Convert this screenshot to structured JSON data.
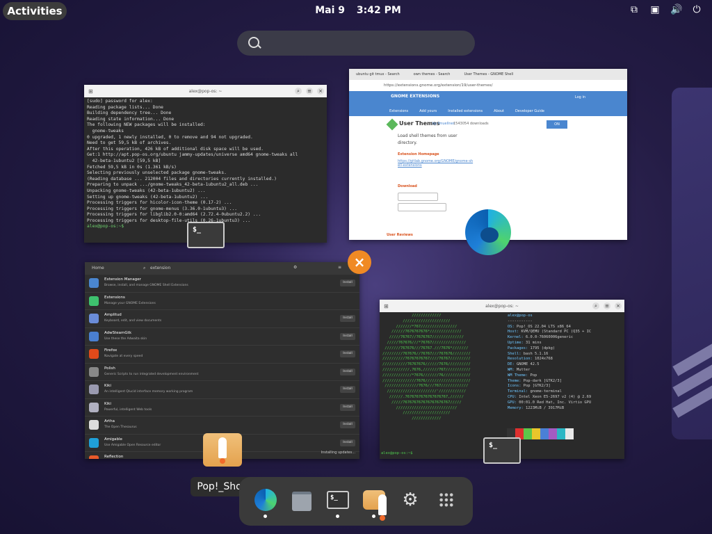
{
  "topbar": {
    "activities_label": "Activities",
    "date": "Mai 9",
    "time": "3:42 PM",
    "tray_icons": [
      "screen-share-icon",
      "keyboard-layout-icon",
      "volume-icon",
      "power-icon"
    ]
  },
  "search": {
    "placeholder": ""
  },
  "terminal_window": {
    "title": "alex@pop-os: ~",
    "lines": [
      "[sudo] password for alex:",
      "Reading package lists... Done",
      "Building dependency tree... Done",
      "Reading state information... Done",
      "The following NEW packages will be installed:",
      "  gnome-tweaks",
      "0 upgraded, 1 newly installed, 0 to remove and 94 not upgraded.",
      "Need to get 59,5 kB of archives.",
      "After this operation, 426 kB of additional disk space will be used.",
      "Get:1 http://apt.pop-os.org/ubuntu jammy-updates/universe amd64 gnome-tweaks all",
      "  42-beta-1ubuntu2 [59,5 kB]",
      "Fetched 59,5 kB in 0s (1.361 kB/s)",
      "Selecting previously unselected package gnome-tweaks.",
      "(Reading database ... 212004 files and directories currently installed.)",
      "Preparing to unpack .../gnome-tweaks_42-beta-1ubuntu2_all.deb ...",
      "Unpacking gnome-tweaks (42-beta-1ubuntu2) ...",
      "Setting up gnome-tweaks (42-beta-1ubuntu2) ...",
      "Processing triggers for hicolor-icon-theme (0.17-2) ...",
      "Processing triggers for gnome-menus (3.36.0-1ubuntu3) ...",
      "Processing triggers for libglib2.0-0:amd64 (2.72.4-0ubuntu2.2) ...",
      "Processing triggers for desktop-file-utils (0.26-1ubuntu3) ...",
      "alex@pop-os:~$ "
    ]
  },
  "browser_window": {
    "tabs": [
      "ubuntu git tmux - Search",
      "own themes - Search",
      "User Themes - GNOME Shell"
    ],
    "url": "https://extensions.gnome.org/extension/19/user-themes/",
    "site_logo": "GNOME EXTENSIONS",
    "nav": [
      "Extensions",
      "Add yours",
      "Installed extensions",
      "About",
      "Developer Guide"
    ],
    "login": "Log in",
    "ext_title": "User Themes",
    "ext_author": "by fmuellner",
    "ext_downloads": "1543054 downloads",
    "ext_desc": "Load shell themes from user directory.",
    "homepage_label": "Extension Homepage",
    "homepage_url": "https://gitlab.gnome.org/GNOME/gnome-shell-extensions",
    "download_label": "Download",
    "reviews_label": "User Reviews",
    "toggle": "ON"
  },
  "shop_window": {
    "home_label": "Home",
    "search_value": "extension",
    "installing_label": "Installing updates...",
    "items": [
      {
        "name": "Extension Manager",
        "desc": "Browse, install, and manage GNOME Shell Extensions",
        "action": "Install",
        "color": "#4a86cf"
      },
      {
        "name": "Extensions",
        "desc": "Manage your GNOME Extensions",
        "action": "",
        "color": "#3ec26e"
      },
      {
        "name": "Amplitud",
        "desc": "Keyboard, edit, and view documents",
        "action": "Install",
        "color": "#6a8cd8"
      },
      {
        "name": "AdwSteamGtk",
        "desc": "Use these the Adwaita skin",
        "action": "Install",
        "color": "#4a7fd0"
      },
      {
        "name": "Firefox",
        "desc": "Navigate at every speed",
        "action": "Install",
        "color": "#e14a1a"
      },
      {
        "name": "Polish",
        "desc": "Generic Scripts to run integrated development environment",
        "action": "Install",
        "color": "#888"
      },
      {
        "name": "Kiki",
        "desc": "An intelligent Qlucid interface memory working program",
        "action": "Install",
        "color": "#9a9ab0"
      },
      {
        "name": "Kiki",
        "desc": "Powerful, intelligent Web tools",
        "action": "Install",
        "color": "#b0b0c0"
      },
      {
        "name": "Artha",
        "desc": "The Open Thesaurus",
        "action": "Install",
        "color": "#ddd"
      },
      {
        "name": "Amigable",
        "desc": "Use Amigable Open Resource editor",
        "action": "Install",
        "color": "#1fa0d8"
      },
      {
        "name": "Reflection",
        "desc": "",
        "action": "",
        "color": "#e85a2a"
      }
    ]
  },
  "neofetch_window": {
    "title": "alex@pop-os: ~",
    "art": [
      "             /////////////",
      "         /////////////////////",
      "      ///////*767////////////////",
      "    //////7676767676*//////////////",
      "   /////76767//7676767//////////////",
      "  /////767676///*76767///////////////",
      " ///////767676///76767.///7676*///////",
      "/////////767676//76767///767676////////",
      "//////////76767676767////76767/////////",
      "///////////76767676//////7676//////////",
      "////////////,7676,///////767///////////",
      "/////////////*7676///////76////////////",
      "///////////////7676////////////////////",
      " ///////////////7676///767////////////",
      "  //////////////////////'////////////",
      "   //////.7676767676767676767,//////",
      "    /////767676767676767676767/////",
      "      ///////////////////////////",
      "         /////////////////////",
      "             /////////////"
    ],
    "user": "alex@pop-os",
    "sep": "-----------",
    "info": [
      [
        "OS",
        "Pop!_OS 22.04 LTS x86_64"
      ],
      [
        "Host",
        "KVM/QEMU (Standard PC (Q35 + IC"
      ],
      [
        "Kernel",
        "6.0.0-76060006generic"
      ],
      [
        "Uptime",
        "31 mins"
      ],
      [
        "Packages",
        "1795 (dpkg)"
      ],
      [
        "Shell",
        "bash 5.1.16"
      ],
      [
        "Resolution",
        "1024x768"
      ],
      [
        "DE",
        "GNOME 42.5"
      ],
      [
        "WM",
        "Mutter"
      ],
      [
        "WM Theme",
        "Pop"
      ],
      [
        "Theme",
        "Pop-dark [GTK2/3]"
      ],
      [
        "Icons",
        "Pop [GTK2/3]"
      ],
      [
        "Terminal",
        "gnome-terminal"
      ],
      [
        "CPU",
        "Intel Xeon E5-2697 v2 (4) @ 2.69"
      ],
      [
        "GPU",
        "00:01.0 Red Hat, Inc. Virtio GPU"
      ],
      [
        "Memory",
        "1223MiB / 3917MiB"
      ]
    ],
    "prompt": "alex@pop-os:~$ ",
    "swatch_colors": [
      "#333333",
      "#e0302f",
      "#5ec74a",
      "#e9c62b",
      "#4a80d6",
      "#a45bc2",
      "#2cb6c4",
      "#e8e8e8"
    ]
  },
  "close_button": {
    "label": "×"
  },
  "tooltip": {
    "label": "Pop!_Shop"
  },
  "dash": {
    "items": [
      {
        "name": "edge",
        "running": true
      },
      {
        "name": "files",
        "running": false
      },
      {
        "name": "terminal",
        "running": true
      },
      {
        "name": "pop-shop",
        "running": true
      },
      {
        "name": "settings",
        "running": false
      },
      {
        "name": "app-grid",
        "running": false
      }
    ],
    "terminal_glyph": "$_"
  }
}
